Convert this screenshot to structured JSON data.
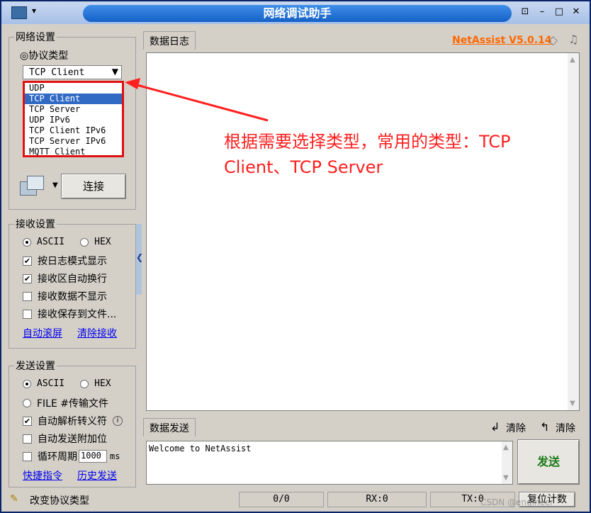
{
  "window": {
    "title": "网络调试助手"
  },
  "network_settings": {
    "legend": "网络设置",
    "protocol_label": "◎协议类型",
    "selected": "TCP Client",
    "options": [
      "UDP",
      "TCP Client",
      "TCP Server",
      "UDP IPv6",
      "TCP Client IPv6",
      "TCP Server IPv6",
      "MQTT Client"
    ],
    "connect_label": "连接"
  },
  "receive_settings": {
    "legend": "接收设置",
    "ascii": "ASCII",
    "hex": "HEX",
    "options": [
      "按日志模式显示",
      "接收区自动换行",
      "接收数据不显示",
      "接收保存到文件..."
    ],
    "auto_scroll": "自动滚屏",
    "clear_receive": "清除接收"
  },
  "send_settings": {
    "legend": "发送设置",
    "ascii": "ASCII",
    "hex": "HEX",
    "file": "FILE #传输文件",
    "auto_escape": "自动解析转义符",
    "auto_append": "自动发送附加位",
    "loop_label": "循环周期",
    "loop_value": "1000",
    "loop_unit": "ms",
    "shortcut": "快捷指令",
    "history": "历史发送"
  },
  "log": {
    "tab": "数据日志",
    "brand": "NetAssist V5.0.14"
  },
  "annotation": {
    "text": "根据需要选择类型，常用的类型：TCP Client、TCP Server"
  },
  "send": {
    "tab": "数据发送",
    "clear1": "清除",
    "clear2": "清除",
    "content": "Welcome to NetAssist",
    "send_button": "发送"
  },
  "status": {
    "hint": "改变协议类型",
    "count": "0/0",
    "rx": "RX:0",
    "tx": "TX:0",
    "reset": "复位计数"
  },
  "watermark": "CSDN @engineer"
}
